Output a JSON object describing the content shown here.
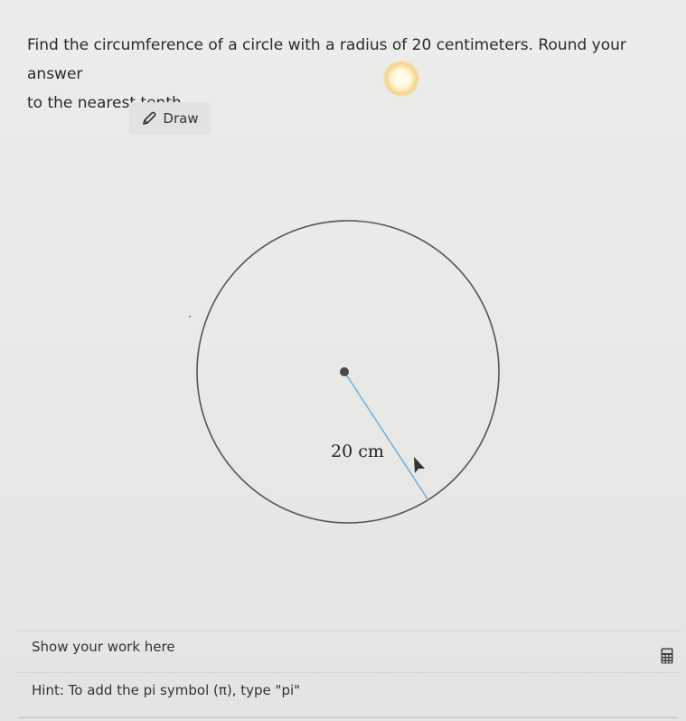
{
  "question": {
    "text_line1": "Find the circumference of a circle with a radius of 20 centimeters. Round your answer",
    "text_line2": "to the nearest tenth."
  },
  "toolbar": {
    "draw_label": "Draw",
    "draw_icon": "pencil-icon"
  },
  "diagram": {
    "radius_label": "20 cm",
    "line_color": "#6aa9d8",
    "circle_color": "#555555",
    "center_color": "#4a4a4a"
  },
  "work": {
    "prompt": "Show your work here",
    "calculator_icon": "calculator-icon"
  },
  "hint": {
    "text": "Hint: To add the pi symbol (π), type \"pi\""
  }
}
